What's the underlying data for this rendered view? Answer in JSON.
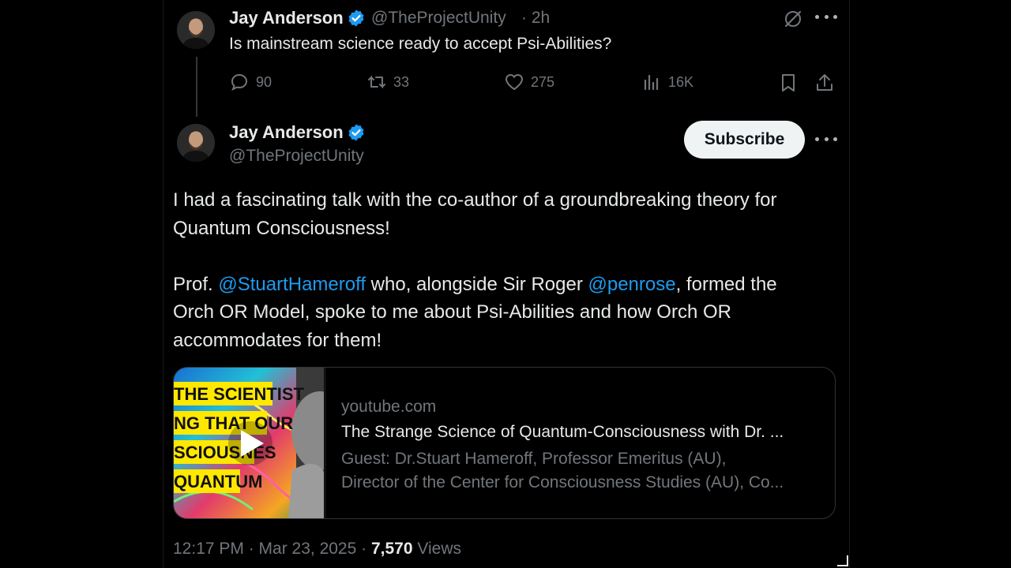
{
  "parent_tweet": {
    "author_name": "Jay Anderson",
    "handle": "@TheProjectUnity",
    "time": "· 2h",
    "text": "Is mainstream science ready to accept Psi-Abilities?",
    "replies": "90",
    "reposts": "33",
    "likes": "275",
    "views": "16K"
  },
  "main_tweet": {
    "author_name": "Jay Anderson",
    "handle": "@TheProjectUnity",
    "subscribe_label": "Subscribe",
    "paragraph1": {
      "line1": "I had a fascinating talk with the co-author of a groundbreaking theory for",
      "line2": "Quantum Consciousness!"
    },
    "paragraph2": {
      "prefix": "Prof. ",
      "mention1": "@StuartHameroff",
      "middle": " who, alongside Sir Roger ",
      "mention2": "@penrose",
      "suffix": ", formed the",
      "line2": "Orch OR Model, spoke to me about Psi-Abilities and how Orch OR",
      "line3": "accommodates for them!"
    },
    "card": {
      "domain": "youtube.com",
      "title": "The Strange Science of Quantum-Consciousness with Dr. ...",
      "desc_line1": "Guest: Dr.Stuart Hameroff, Professor Emeritus (AU),",
      "desc_line2": "Director of the Center for Consciousness Studies (AU), Co...",
      "thumb_lines": [
        "THE SCIENTIST",
        "NG THAT OUR",
        "SCIOUSNES",
        "QUANTUM"
      ]
    },
    "timestamp": "12:17 PM · Mar 23, 2025 · ",
    "view_count": "7,570",
    "views_label": " Views"
  },
  "colors": {
    "accent": "#1d9bf0",
    "muted": "#71767b",
    "text": "#e7e9ea",
    "background": "#000000"
  },
  "icons": [
    "reply-icon",
    "repost-icon",
    "like-icon",
    "views-icon",
    "bookmark-icon",
    "share-icon",
    "grok-icon",
    "more-icon",
    "verified-icon",
    "play-icon"
  ]
}
